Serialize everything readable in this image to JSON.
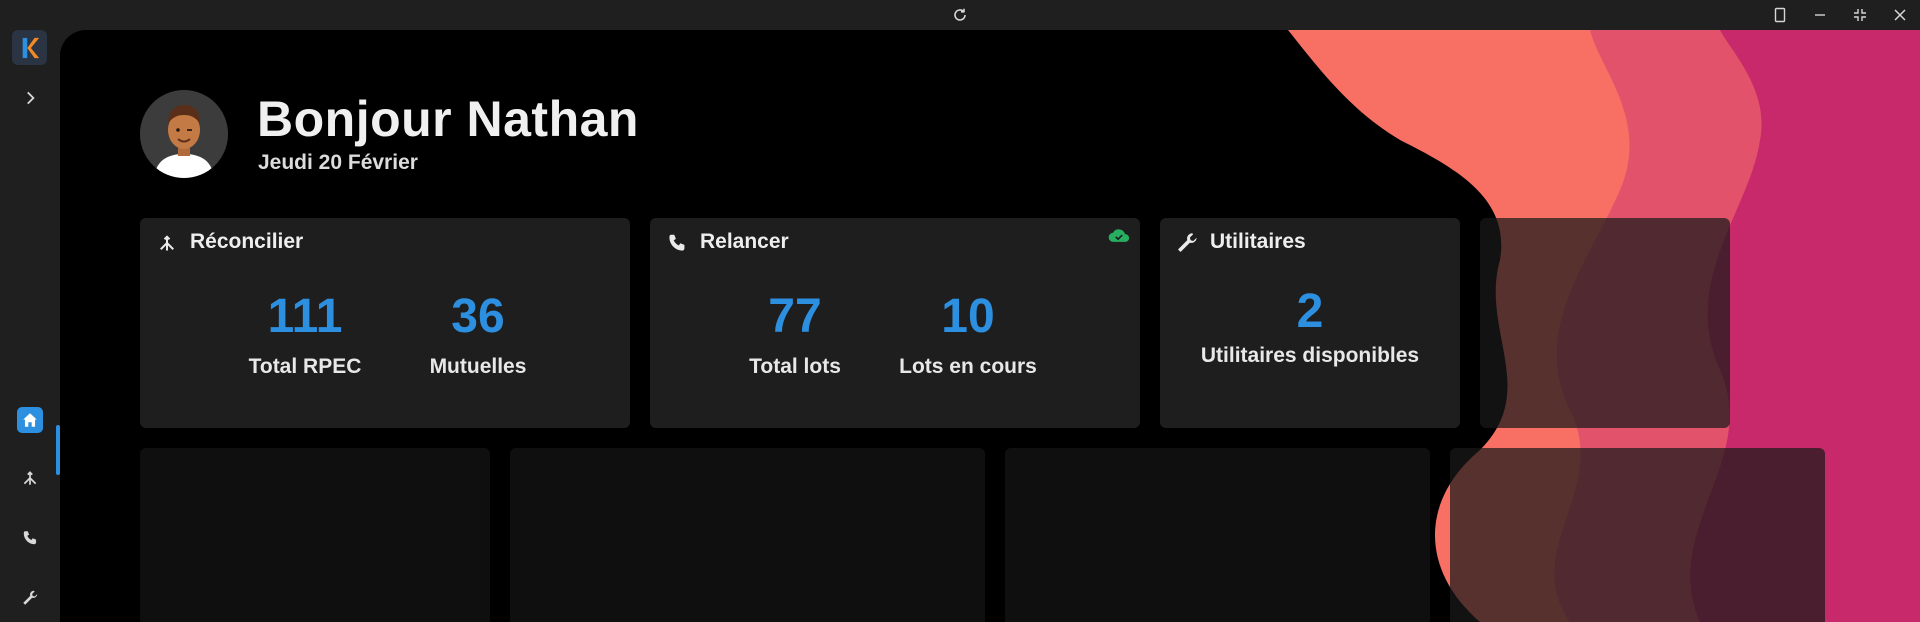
{
  "titlebar": {
    "refresh_icon": "refresh-icon",
    "buttons": [
      "tablet-mode-icon",
      "minimize-icon",
      "restore-icon",
      "close-icon"
    ]
  },
  "rail": {
    "logo_letter": "K",
    "items": [
      {
        "icon": "chevron-right-icon"
      },
      {
        "icon": "home-icon",
        "active": true
      },
      {
        "icon": "merge-icon"
      },
      {
        "icon": "phone-icon"
      },
      {
        "icon": "wrench-icon"
      }
    ]
  },
  "header": {
    "greeting": "Bonjour Nathan",
    "date": "Jeudi 20 Février"
  },
  "cards": [
    {
      "title": "Réconcilier",
      "icon": "merge-icon",
      "stats": [
        {
          "value": "111",
          "label": "Total RPEC"
        },
        {
          "value": "36",
          "label": "Mutuelles"
        }
      ]
    },
    {
      "title": "Relancer",
      "icon": "phone-icon",
      "status_icon": "cloud-check-icon",
      "stats": [
        {
          "value": "77",
          "label": "Total lots"
        },
        {
          "value": "10",
          "label": "Lots en cours"
        }
      ]
    },
    {
      "title": "Utilitaires",
      "icon": "wrench-icon",
      "stats": [
        {
          "value": "2",
          "label": "Utilitaires disponibles"
        }
      ]
    }
  ],
  "colors": {
    "accent": "#2d8fe0",
    "success": "#27ae60",
    "wave_coral": "#f87064",
    "wave_pink": "#e2536b",
    "wave_magenta": "#c8296a"
  }
}
